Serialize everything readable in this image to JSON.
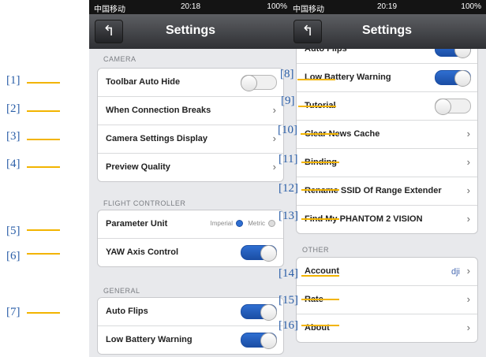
{
  "left_phone": {
    "status": {
      "carrier": "中国移动",
      "time": "20:18",
      "battery": "100%"
    },
    "title": "Settings",
    "back_icon": "back-arrow-icon",
    "camera_section": "CAMERA",
    "camera_rows": [
      {
        "label": "Toolbar Auto Hide",
        "control": "toggle-off"
      },
      {
        "label": "When Connection Breaks",
        "control": "chevron"
      },
      {
        "label": "Camera Settings Display",
        "control": "chevron"
      },
      {
        "label": "Preview Quality",
        "control": "chevron"
      }
    ],
    "flight_section": "FLIGHT CONTROLLER",
    "flight_rows": [
      {
        "label": "Parameter Unit",
        "opt1": "Imperial",
        "opt2": "Metric"
      },
      {
        "label": "YAW Axis Control",
        "control": "toggle-on"
      }
    ],
    "general_section": "GENERAL",
    "general_rows": [
      {
        "label": "Auto Flips",
        "control": "toggle-on"
      },
      {
        "label": "Low Battery Warning",
        "control": "toggle-on"
      }
    ]
  },
  "right_phone": {
    "status": {
      "carrier": "中国移动",
      "time": "20:19",
      "battery": "100%"
    },
    "title": "Settings",
    "back_icon": "back-arrow-icon",
    "top_rows": [
      {
        "label": "Auto Flips",
        "control": "toggle-on"
      },
      {
        "label": "Low Battery Warning",
        "control": "toggle-on"
      },
      {
        "label": "Tutorial",
        "control": "toggle-off"
      },
      {
        "label": "Clear News Cache",
        "control": "chevron"
      },
      {
        "label": "Binding",
        "control": "chevron"
      },
      {
        "label": "Rename SSID Of Range Extender",
        "control": "chevron"
      },
      {
        "label": "Find My PHANTOM 2 VISION",
        "control": "chevron"
      }
    ],
    "other_section": "OTHER",
    "other_rows": [
      {
        "label": "Account",
        "value": "dji",
        "control": "chevron"
      },
      {
        "label": "Rate",
        "control": "chevron"
      },
      {
        "label": "About",
        "control": "chevron"
      }
    ]
  },
  "callouts": [
    "[1]",
    "[2]",
    "[3]",
    "[4]",
    "[5]",
    "[6]",
    "[7]",
    "[8]",
    "[9]",
    "[10]",
    "[11]",
    "[12]",
    "[13]",
    "[14]",
    "[15]",
    "[16]"
  ],
  "colors": {
    "accent": "#2b5fa8",
    "callout_line": "#f2b400",
    "toggle_on": "#2f6fd1"
  }
}
